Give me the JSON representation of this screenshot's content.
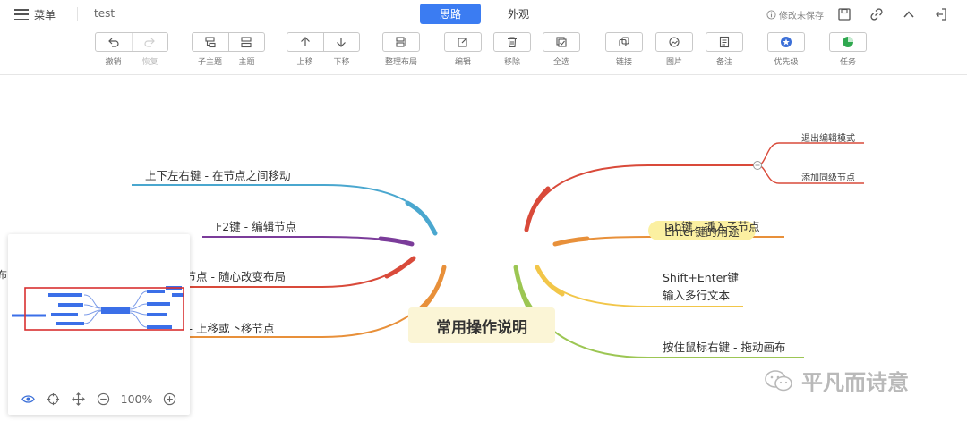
{
  "header": {
    "menu_label": "菜单",
    "doc_title": "test",
    "tabs": [
      {
        "label": "思路",
        "active": true
      },
      {
        "label": "外观",
        "active": false
      }
    ],
    "save_status": "修改未保存"
  },
  "toolbar": {
    "undo": "撤销",
    "redo": "恢复",
    "child_topic": "子主题",
    "topic": "主题",
    "move_up": "上移",
    "move_down": "下移",
    "arrange_layout": "整理布局",
    "edit": "编辑",
    "remove": "移除",
    "select_all": "全选",
    "link": "链接",
    "image": "图片",
    "note": "备注",
    "priority": "优先级",
    "task": "任务"
  },
  "mindmap": {
    "root": "常用操作说明",
    "left": [
      "上下左右键 - 在节点之间移动",
      "F2键 - 编辑节点",
      "拖动节点 - 随心改变布局",
      "上下  -  上移或下移节点"
    ],
    "left_partial": [
      "动节点 - 随心改变布局",
      "下  -  上移或下移节点"
    ],
    "edge_fragment": "布",
    "right": {
      "enter": "Enter键的用途",
      "enter_children": [
        "退出编辑模式",
        "添加同级节点"
      ],
      "tab": "Tab键 - 插入子节点",
      "shift_enter_line1": "Shift+Enter键",
      "shift_enter_line2": "输入多行文本",
      "right_mouse": "按住鼠标右键 - 拖动画布"
    },
    "colors": {
      "blue": "#4aa7cf",
      "purple": "#7b3c9a",
      "red": "#d94a3a",
      "orange": "#e8903a",
      "yellow": "#f2c649",
      "green": "#9cc653",
      "accent": "#3b7cf2"
    }
  },
  "minimap": {
    "zoom": "100%"
  },
  "watermark": "平凡而诗意"
}
